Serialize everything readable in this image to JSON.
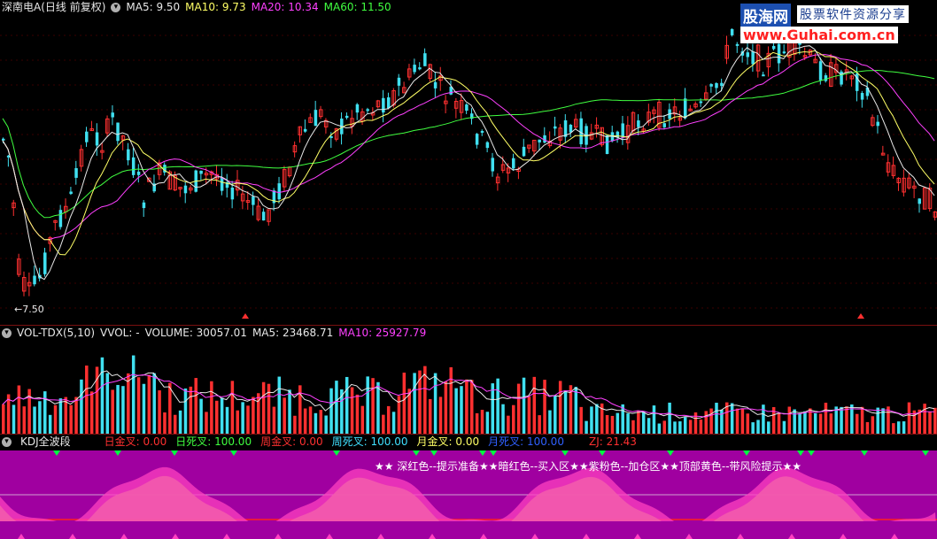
{
  "main": {
    "title": "深南电A(日线 前复权)",
    "ma": [
      {
        "label": "MA5: 9.50",
        "color": "#e8e8e8"
      },
      {
        "label": "MA10: 9.73",
        "color": "#ffff66"
      },
      {
        "label": "MA20: 10.34",
        "color": "#ff40ff"
      },
      {
        "label": "MA60: 11.50",
        "color": "#40ff40"
      }
    ],
    "low_label": "←7.50"
  },
  "brand": {
    "logo": "股海网",
    "slogan": "股票软件资源分享",
    "url": "www.Guhai.com.cn"
  },
  "volume": {
    "title": "VOL-TDX(5,10)",
    "fields": [
      {
        "label": "VVOL: -",
        "color": "#e8e8e8"
      },
      {
        "label": "VOLUME: 30057.01",
        "color": "#e8e8e8"
      },
      {
        "label": "MA5: 23468.71",
        "color": "#e8e8e8"
      },
      {
        "label": "MA10: 25927.79",
        "color": "#ff40ff"
      }
    ]
  },
  "kdj": {
    "title": "KDJ全波段",
    "fields": [
      {
        "label": "日金叉: 0.00",
        "color": "#ff3030"
      },
      {
        "label": "日死叉: 100.00",
        "color": "#40ff40"
      },
      {
        "label": "周金叉: 0.00",
        "color": "#ff3030"
      },
      {
        "label": "周死叉: 100.00",
        "color": "#40e0ff"
      },
      {
        "label": "月金叉: 0.00",
        "color": "#ffff66"
      },
      {
        "label": "月死叉: 100.00",
        "color": "#3060ff"
      },
      {
        "label": "ZJ: 21.43",
        "color": "#ff3030"
      }
    ],
    "legend_text": "★★ 深红色--提示准备★★暗红色--买入区★★紫粉色--加仓区★★顶部黄色--带风险提示★★"
  },
  "colors": {
    "up": "#ff3030",
    "down": "#40e0f0",
    "ma5": "#e8e8e8",
    "ma10": "#ffff66",
    "ma20": "#ff40ff",
    "ma60": "#40ff40",
    "kdj_bg": "#a000a0",
    "kdj_pink": "#ff40c0",
    "kdj_tan": "#d0b070",
    "green_marker": "#00ff40"
  }
}
